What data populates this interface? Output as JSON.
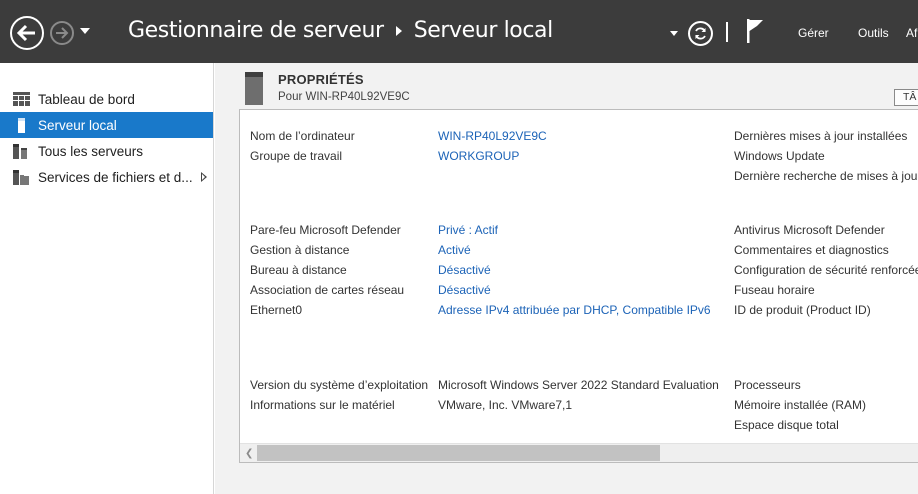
{
  "titlebar": {
    "breadcrumb_root": "Gestionnaire de serveur",
    "breadcrumb_current": "Serveur local",
    "menu_manage": "Gérer",
    "menu_tools": "Outils",
    "menu_display": "Af"
  },
  "sidebar": {
    "items": [
      {
        "label": "Tableau de bord",
        "icon": "dashboard-icon"
      },
      {
        "label": "Serveur local",
        "icon": "local-server-icon",
        "selected": true
      },
      {
        "label": "Tous les serveurs",
        "icon": "all-servers-icon"
      },
      {
        "label": "Services de fichiers et d...",
        "icon": "file-services-icon"
      }
    ]
  },
  "properties": {
    "title": "PROPRIÉTÉS",
    "subtitle": "Pour WIN-RP40L92VE9C",
    "tasks_label": "TÂ",
    "computer_name_label": "Nom de l’ordinateur",
    "computer_name_value": "WIN-RP40L92VE9C",
    "workgroup_label": "Groupe de travail",
    "workgroup_value": "WORKGROUP",
    "firewall_label": "Pare-feu Microsoft Defender",
    "firewall_value": "Privé : Actif",
    "remote_mgmt_label": "Gestion à distance",
    "remote_mgmt_value": "Activé",
    "remote_desktop_label": "Bureau à distance",
    "remote_desktop_value": "Désactivé",
    "nic_teaming_label": "Association de cartes réseau",
    "nic_teaming_value": "Désactivé",
    "ethernet_label": "Ethernet0",
    "ethernet_value": "Adresse IPv4 attribuée par DHCP, Compatible IPv6",
    "os_version_label": "Version du système d’exploitation",
    "os_version_value": "Microsoft Windows Server 2022 Standard Evaluation",
    "hardware_label": "Informations sur le matériel",
    "hardware_value": "VMware, Inc. VMware7,1",
    "updates_installed_label": "Dernières mises à jour installées",
    "windows_update_label": "Windows Update",
    "last_check_label": "Dernière recherche de mises à jour",
    "antivirus_label": "Antivirus Microsoft Defender",
    "feedback_label": "Commentaires et diagnostics",
    "ie_security_label": "Configuration de sécurité renforcée",
    "timezone_label": "Fuseau horaire",
    "product_id_label": "ID de produit (Product ID)",
    "processors_label": "Processeurs",
    "ram_label": "Mémoire installée (RAM)",
    "disk_label": "Espace disque total"
  }
}
